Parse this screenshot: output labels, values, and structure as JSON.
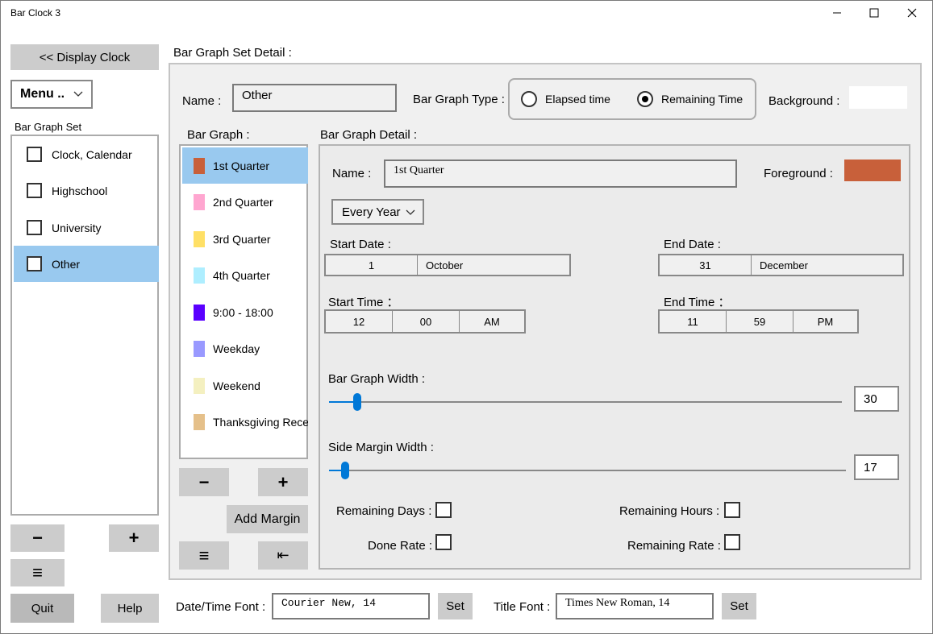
{
  "window": {
    "title": "Bar Clock 3"
  },
  "left": {
    "display_clock_label": "<< Display Clock",
    "menu_label": "Menu ..",
    "bar_graph_set_label": "Bar Graph Set",
    "sets": [
      {
        "label": "Clock, Calendar"
      },
      {
        "label": "Highschool"
      },
      {
        "label": "University"
      },
      {
        "label": "Other"
      }
    ],
    "minus_label": "−",
    "plus_label": "+",
    "list_icon": "≡",
    "quit_label": "Quit",
    "help_label": "Help"
  },
  "detail": {
    "section_title": "Bar Graph Set Detail :",
    "name_label": "Name :",
    "name_value": "Other",
    "type_label": "Bar Graph Type :",
    "type_options": [
      "Elapsed time",
      "Remaining Time"
    ],
    "selected_type": "Remaining Time",
    "background_label": "Background :",
    "background_color": "#ffffff",
    "bar_graph_label": "Bar Graph :",
    "bar_graphs": [
      {
        "label": "1st Quarter",
        "color": "#c8603a"
      },
      {
        "label": "2nd Quarter",
        "color": "#ffa6d0"
      },
      {
        "label": "3rd Quarter",
        "color": "#ffe066"
      },
      {
        "label": "4th Quarter",
        "color": "#aeeeff"
      },
      {
        "label": "9:00 - 18:00",
        "color": "#5a00ff"
      },
      {
        "label": "Weekday",
        "color": "#9999ff"
      },
      {
        "label": "Weekend",
        "color": "#f4f0c0"
      },
      {
        "label": "Thanksgiving Recess",
        "color": "#e5c08a"
      }
    ],
    "list_minus_label": "−",
    "list_plus_label": "+",
    "add_margin_label": "Add Margin",
    "list_icon": "≡",
    "move_icon": "⇤"
  },
  "graph_detail": {
    "title": "Bar Graph Detail :",
    "name_label": "Name :",
    "name_value": "1st Quarter",
    "foreground_label": "Foreground :",
    "foreground_color": "#c8603a",
    "repeat_value": "Every Year",
    "start_date_label": "Start Date :",
    "start_date": {
      "day": "1",
      "month": "October"
    },
    "end_date_label": "End Date :",
    "end_date": {
      "day": "31",
      "month": "December"
    },
    "start_time_label": "Start Time ：",
    "start_time": {
      "hour": "12",
      "minute": "00",
      "ampm": "AM"
    },
    "end_time_label": "End Time ：",
    "end_time": {
      "hour": "11",
      "minute": "59",
      "ampm": "PM"
    },
    "width_label": "Bar Graph Width :",
    "width_value": "30",
    "margin_label": "Side Margin Width :",
    "margin_value": "17",
    "remaining_days_label": "Remaining Days :",
    "remaining_hours_label": "Remaining Hours :",
    "done_rate_label": "Done Rate :",
    "remaining_rate_label": "Remaining Rate :"
  },
  "footer": {
    "datetime_font_label": "Date/Time Font :",
    "datetime_font_value": "Courier New, 14",
    "set_label": "Set",
    "title_font_label": "Title Font :",
    "title_font_value": "Times New Roman, 14"
  }
}
